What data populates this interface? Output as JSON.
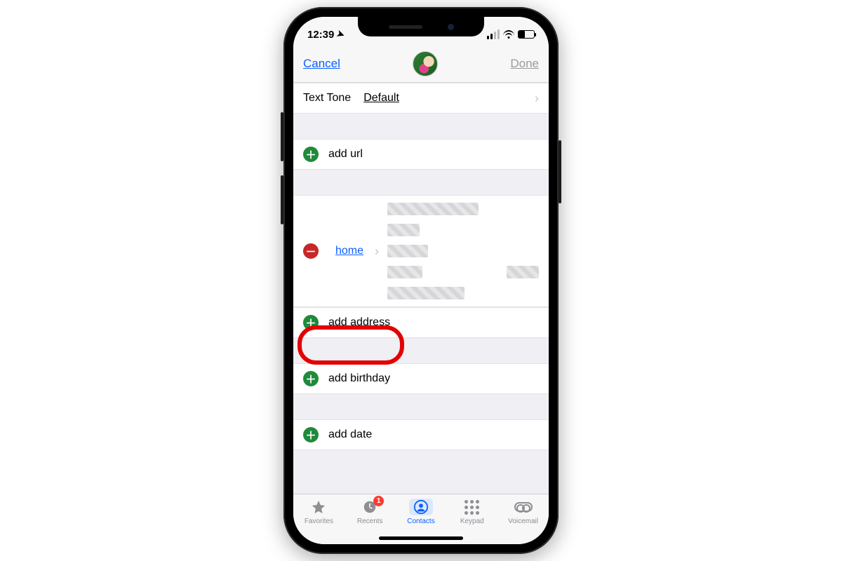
{
  "status": {
    "time": "12:39"
  },
  "nav": {
    "cancel": "Cancel",
    "done": "Done"
  },
  "texttone": {
    "label": "Text Tone",
    "value": "Default"
  },
  "rows": {
    "add_url": "add url",
    "home_label": "home",
    "add_address": "add address",
    "add_birthday": "add birthday",
    "add_date": "add date"
  },
  "tabs": {
    "favorites": "Favorites",
    "recents": "Recents",
    "recents_badge": "1",
    "contacts": "Contacts",
    "keypad": "Keypad",
    "voicemail": "Voicemail"
  }
}
